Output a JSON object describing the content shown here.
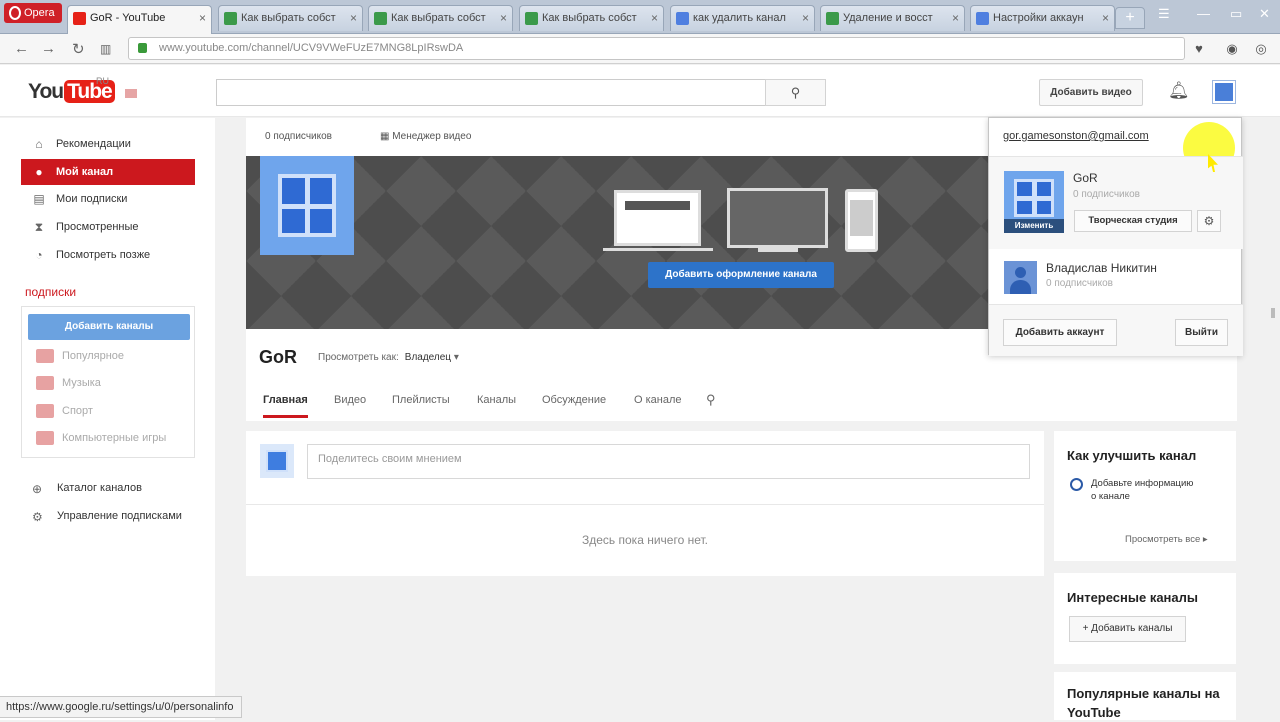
{
  "browser": {
    "app_label": "Opera",
    "tabs": [
      {
        "title": "GoR - YouTube",
        "active": true
      },
      {
        "title": "Как выбрать собст"
      },
      {
        "title": "Как выбрать собст"
      },
      {
        "title": "Как выбрать собст"
      },
      {
        "title": "как удалить канал"
      },
      {
        "title": "Удаление и восст"
      },
      {
        "title": "Настройки аккаун"
      }
    ],
    "url": "www.youtube.com/channel/UCV9VWeFUzE7MNG8LpIRswDA",
    "status_url": "https://www.google.ru/settings/u/0/personalinfo"
  },
  "header": {
    "logo_you": "You",
    "logo_tube": "Tube",
    "logo_region": "RU",
    "upload_label": "Добавить видео"
  },
  "sidebar": {
    "items": [
      {
        "label": "Рекомендации",
        "icon": "home-icon"
      },
      {
        "label": "Мой канал",
        "icon": "user-icon"
      },
      {
        "label": "Мои подписки",
        "icon": "subscriptions-icon"
      },
      {
        "label": "Просмотренные",
        "icon": "hourglass-icon"
      },
      {
        "label": "Посмотреть позже",
        "icon": "clock-icon"
      }
    ],
    "subs_title": "подписки",
    "add_channels_label": "Добавить каналы",
    "sub_items": [
      "Популярное",
      "Музыка",
      "Спорт",
      "Компьютерные игры"
    ],
    "footer": [
      "Каталог каналов",
      "Управление подписками"
    ]
  },
  "channel": {
    "subscribers": "0 подписчиков",
    "video_manager": "Менеджер видео",
    "add_art_label": "Добавить оформление канала",
    "name": "GoR",
    "view_as_label": "Просмотреть как:",
    "view_as_value": "Владелец",
    "tabs": [
      "Главная",
      "Видео",
      "Плейлисты",
      "Каналы",
      "Обсуждение",
      "О канале"
    ]
  },
  "feed": {
    "share_placeholder": "Поделитесь своим мнением",
    "empty_text": "Здесь пока ничего нет."
  },
  "cards": {
    "improve_title": "Как улучшить канал",
    "improve_tip": "Добавьте информацию о канале",
    "view_all": "Просмотреть все",
    "interesting_title": "Интересные каналы",
    "add_channels": "+ Добавить каналы",
    "popular_title": "Популярные каналы на YouTube"
  },
  "popup": {
    "email": "gor.gamesonston@gmail.com",
    "account1_name": "GoR",
    "account1_subs": "0 подписчиков",
    "change_label": "Изменить",
    "studio_label": "Творческая студия",
    "account2_name": "Владислав Никитин",
    "account2_subs": "0 подписчиков",
    "add_account_label": "Добавить аккаунт",
    "logout_label": "Выйти"
  }
}
